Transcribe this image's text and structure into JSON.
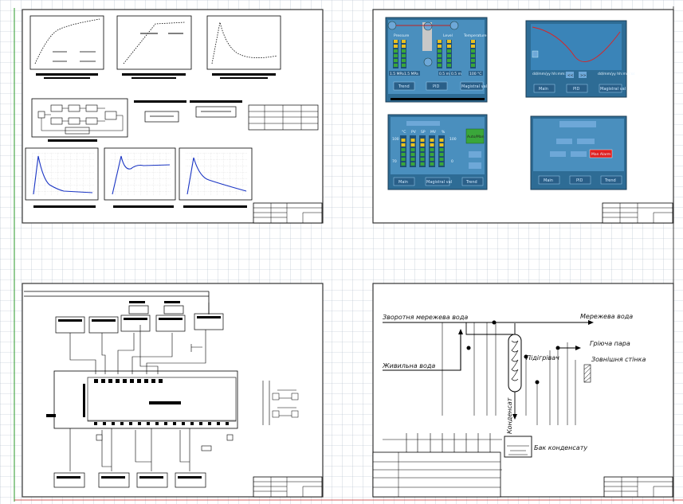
{
  "colors": {
    "grid": "#aeb7c7",
    "sheet_border": "#333333",
    "hmi_panel": "#2e6c95",
    "hmi_screen": "#4a8fbe",
    "plot_line": "#1a35c4",
    "red_curve": "#e02020",
    "led_green": "#3aa63a"
  },
  "hmi_panel_1": {
    "titles": [
      "Pressure",
      "Level",
      "Temperature"
    ],
    "readouts": [
      "1.5 MPa",
      "1.5 MPa",
      "0.5 m",
      "0.5 m",
      "100 °C"
    ],
    "buttons": [
      "Trend",
      "PID",
      "Magistral val"
    ]
  },
  "hmi_panel_2": {
    "axis_left": "dd/mm/yy\nhh:mm:ss",
    "axis_right": "dd/mm/yy\nhh:mm:ss",
    "nav_buttons": [
      "<<",
      ">>"
    ],
    "buttons": [
      "Main",
      "PID",
      "Magistral val"
    ]
  },
  "hmi_panel_3": {
    "column_headers": [
      "°C",
      "PV",
      "SP",
      "MV",
      "%"
    ],
    "scale_top_left": "100",
    "scale_bottom_left": "70",
    "scale_top_right": "100",
    "scale_bottom_right": "0",
    "side_button": "Auto/Man",
    "buttons": [
      "Main",
      "Magistral val",
      "Trend"
    ]
  },
  "hmi_panel_4": {
    "alarm_button": "Man Alarm",
    "buttons": [
      "Main",
      "PID",
      "Trend"
    ]
  },
  "scheme": {
    "label_return_water": "Зворотня мережева вода",
    "label_network_water": "Мережева вода",
    "label_heating_steam": "Гріюча пара",
    "label_feed_water": "Живильна вода",
    "label_heater": "Підігрівач",
    "label_outer_wall": "Зовнішня стінка",
    "label_condensate": "Конденсат",
    "label_condensate_tank": "Бак конденсату"
  }
}
